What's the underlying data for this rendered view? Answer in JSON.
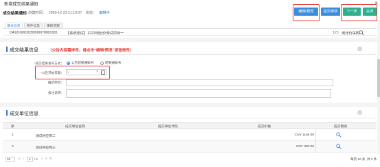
{
  "window": {
    "title": "新增成交结果通知",
    "close_glyph": "×"
  },
  "header": {
    "title": "成交结果通知",
    "created_label": "创建时间：",
    "created_time": "2020-12-23 21:19:07",
    "status_label": "状态：",
    "status": "编辑中"
  },
  "toolbar": {
    "edit_label": "编辑/预览",
    "submit_label": "提交审核",
    "next_label": "下一步",
    "close_label": "关闭"
  },
  "tabs": [
    {
      "label": "基本信息",
      "active": true
    },
    {
      "label": "附件信息",
      "active": false
    },
    {
      "label": "审核流程",
      "active": false
    }
  ],
  "project": {
    "code": "D41010002030000078001001",
    "name": "【系统测试】1222询比价测试项目一",
    "count": "123",
    "winner_label": "询比价采购"
  },
  "section_result": {
    "title": "成交结果信息",
    "hint": "（公告内容需修改，请点击“编辑/预览”按钮修改）"
  },
  "form": {
    "method_label": "成交结果发布方式：",
    "method_options": [
      {
        "label": "公告结果通知书",
        "checked": true
      },
      {
        "label": "结果通知书",
        "checked": false
      }
    ],
    "date_label": "公告开始日期：",
    "date_value": "×",
    "date_clear": "×",
    "reason_label": "推迟原因：",
    "remark_label": "备注说明："
  },
  "section_units": {
    "title": "成交单位信息"
  },
  "table": {
    "headers": [
      "序",
      "成交单位名称",
      "成交单位代码",
      "成交价格",
      "成交物资"
    ],
    "rows": [
      {
        "no": "1",
        "name": "测试供应商二",
        "code": "",
        "price": "CNY 1166.00"
      },
      {
        "no": "2",
        "name": "测试供应商三",
        "code": "",
        "price": "CNY 330.00"
      }
    ]
  },
  "pagination": {
    "page_size": "10",
    "current_page": "1",
    "total_pages": "/ 1",
    "summary": "每页 10 条, 共 2 条",
    "first": "«",
    "prev": "‹",
    "next": "›",
    "last": "»",
    "refresh": "↻"
  },
  "colors": {
    "accent": "#3c8ddc",
    "green": "#2db08e",
    "red": "#e53935"
  }
}
